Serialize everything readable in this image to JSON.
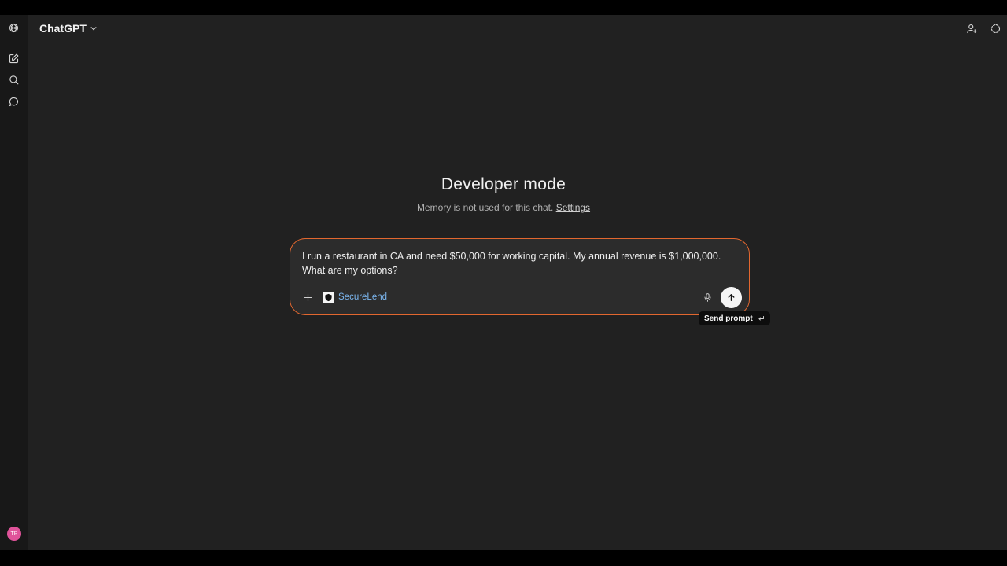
{
  "header": {
    "model_name": "ChatGPT"
  },
  "sidebar": {
    "items": [
      {
        "icon": "openai-logo-icon"
      },
      {
        "icon": "new-chat-icon"
      },
      {
        "icon": "search-icon"
      },
      {
        "icon": "chat-bubble-icon"
      }
    ],
    "avatar_initials": "TP"
  },
  "main": {
    "title": "Developer mode",
    "subtitle_text": "Memory is not used for this chat.",
    "subtitle_link": "Settings"
  },
  "composer": {
    "prompt_line1": "I run a restaurant in CA and need $50,000 for working capital. My annual revenue is $1,000,000.",
    "prompt_line2": "What are my options?",
    "connector_label": "SecureLend",
    "accent_color": "#e2672f"
  },
  "tooltip": {
    "label": "Send prompt"
  },
  "colors": {
    "background": "#212121",
    "sidebar": "#181818",
    "connector_text": "#7cb7f0",
    "avatar": "#e0539a"
  }
}
